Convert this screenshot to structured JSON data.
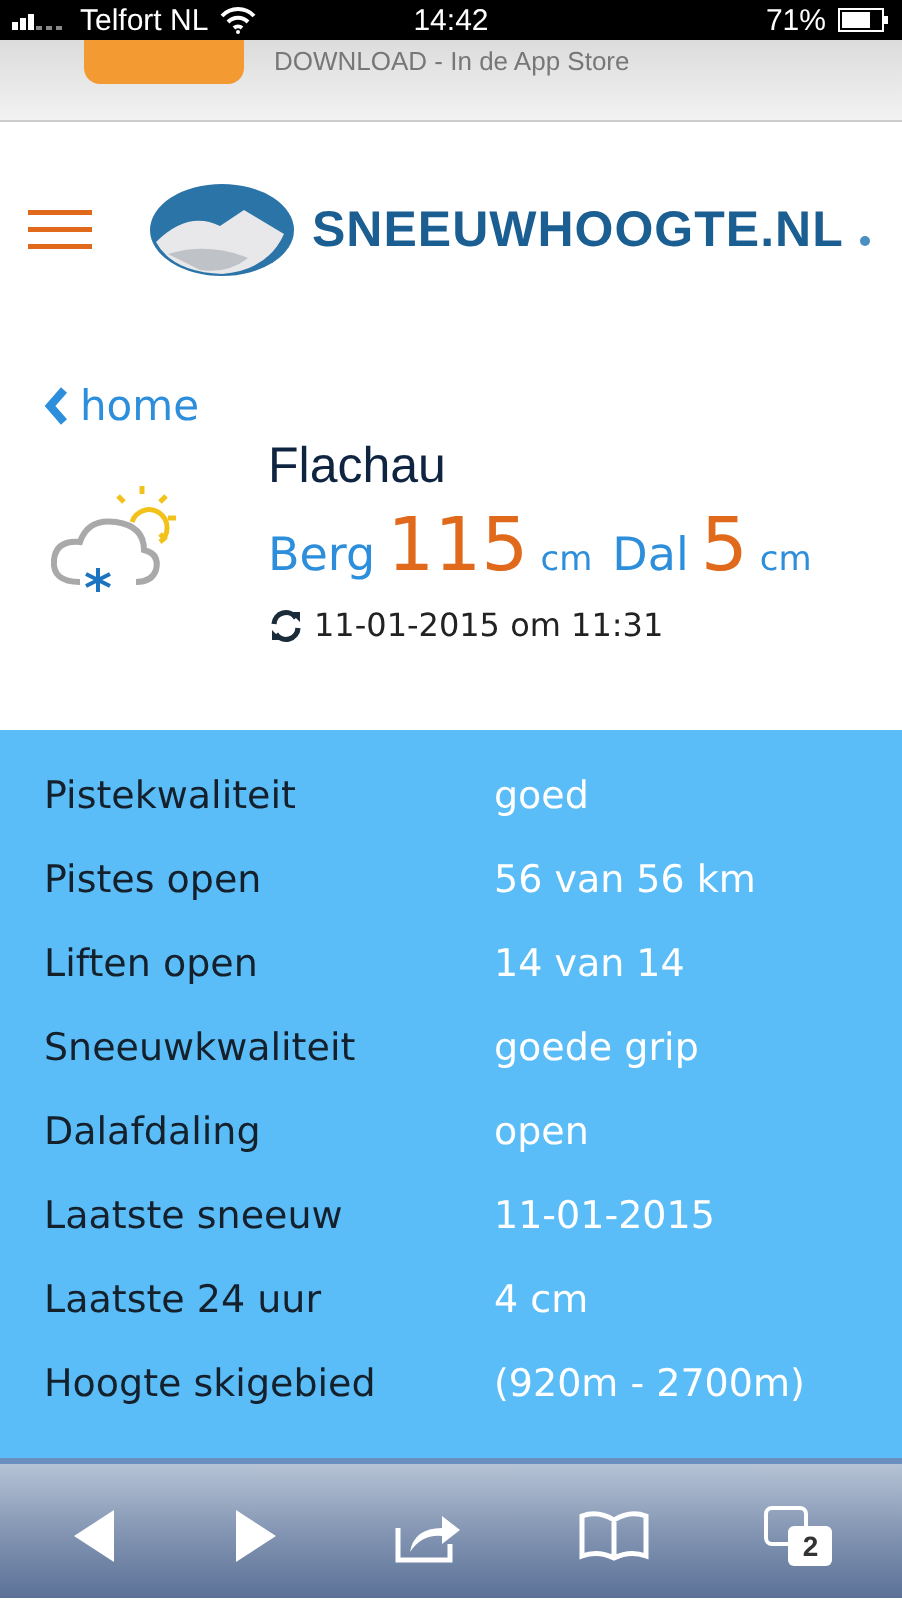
{
  "status_bar": {
    "carrier": "Telfort NL",
    "time": "14:42",
    "battery": "71%"
  },
  "banner": {
    "text": "DOWNLOAD - In de App Store"
  },
  "header": {
    "logo_text": "SNEEUWHOOGTE.NL"
  },
  "back_link": {
    "label": "home"
  },
  "resort": {
    "name": "Flachau",
    "mountain_label": "Berg",
    "mountain_depth": "115",
    "mountain_unit": "cm",
    "valley_label": "Dal",
    "valley_depth": "5",
    "valley_unit": "cm",
    "updated": "11-01-2015 om 11:31"
  },
  "stats": [
    {
      "label": "Pistekwaliteit",
      "value": "goed"
    },
    {
      "label": "Pistes open",
      "value": "56 van 56 km"
    },
    {
      "label": "Liften open",
      "value": "14 van 14"
    },
    {
      "label": "Sneeuwkwaliteit",
      "value": "goede grip"
    },
    {
      "label": "Dalafdaling",
      "value": "open"
    },
    {
      "label": "Laatste sneeuw",
      "value": "11-01-2015"
    },
    {
      "label": "Laatste 24 uur",
      "value": "4 cm"
    },
    {
      "label": "Hoogte skigebied",
      "value": "(920m - 2700m)"
    }
  ],
  "toolbar": {
    "tab_count": "2"
  }
}
